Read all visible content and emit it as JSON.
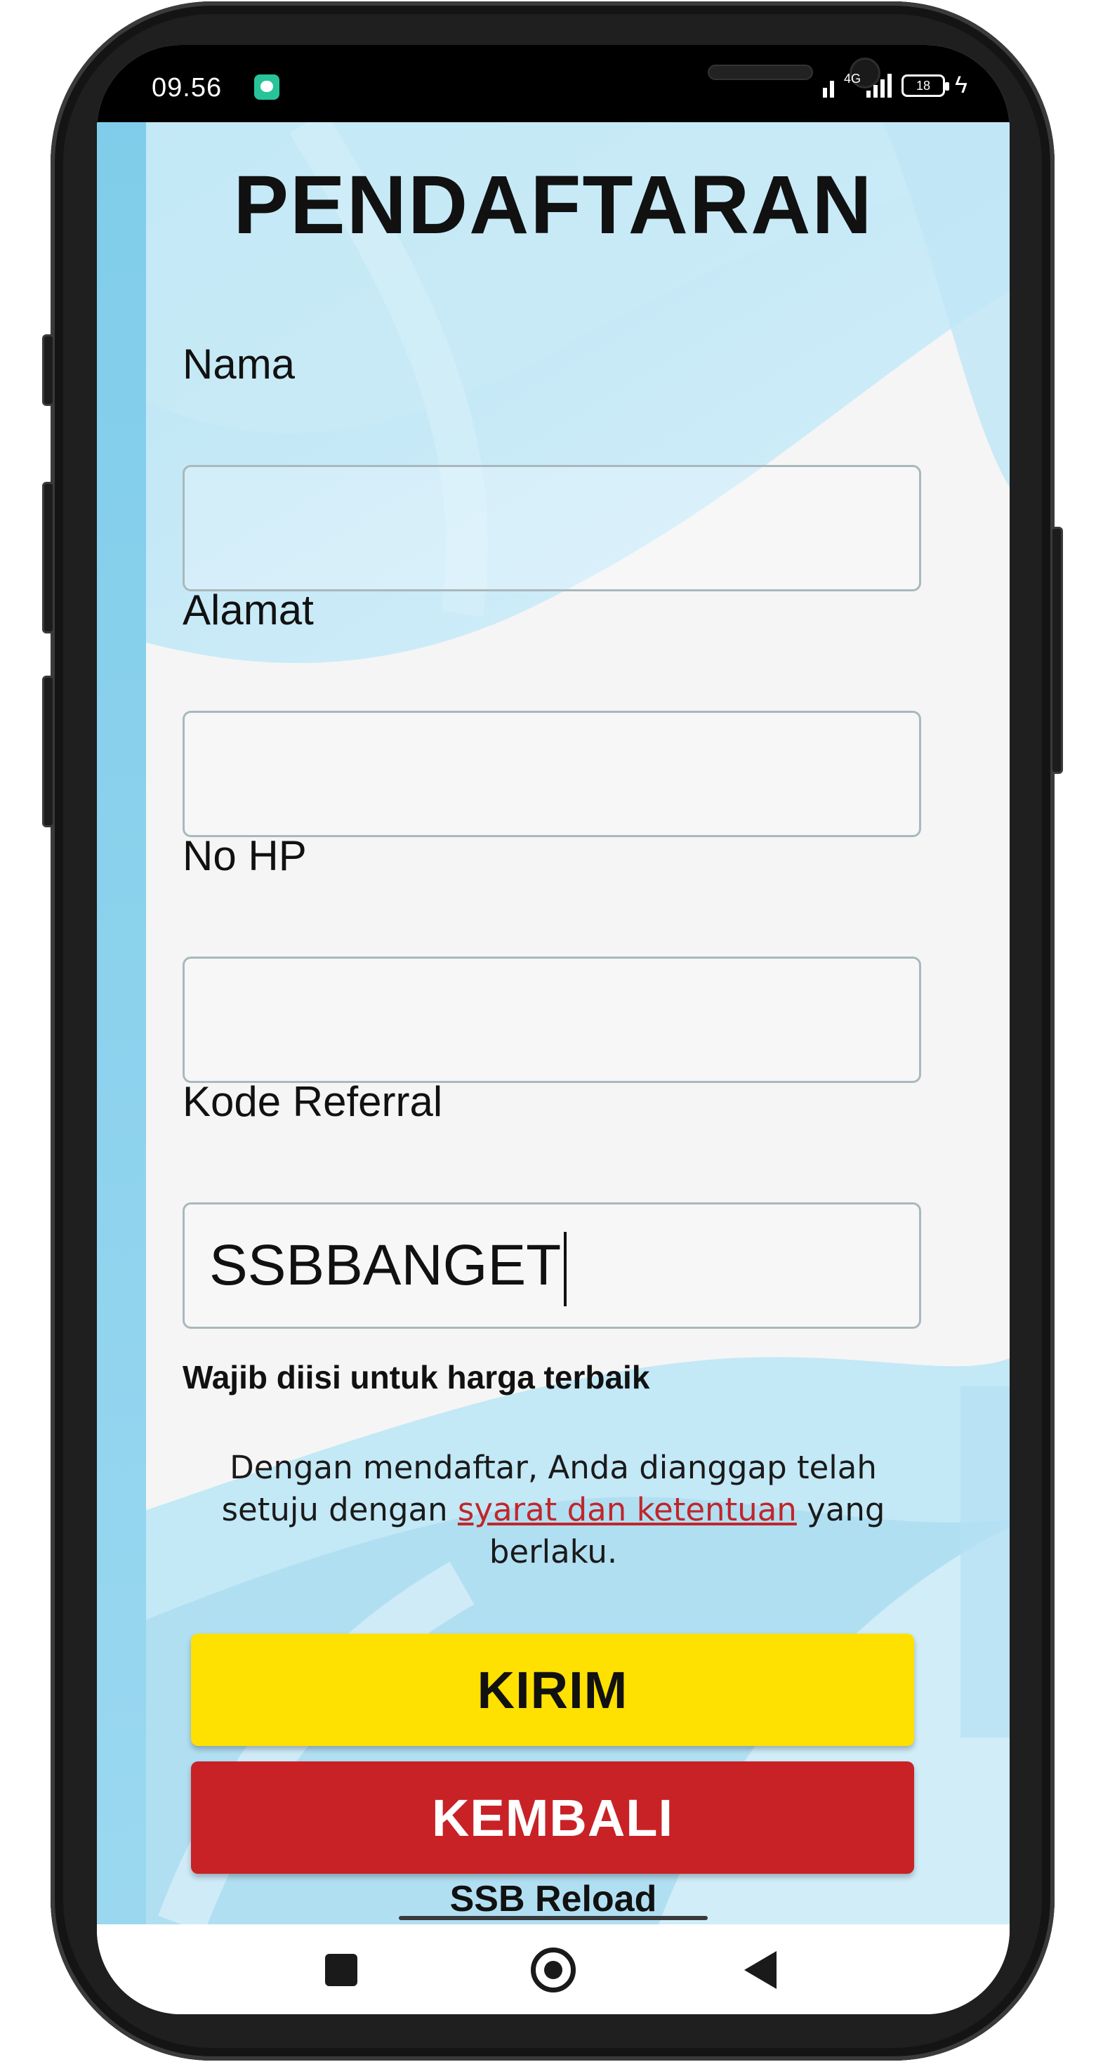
{
  "status_bar": {
    "time": "09.56",
    "network_label": "4G",
    "battery_level": "18"
  },
  "form": {
    "title": "PENDAFTARAN",
    "fields": [
      {
        "label": "Nama",
        "value": ""
      },
      {
        "label": "Alamat",
        "value": ""
      },
      {
        "label": "No HP",
        "value": ""
      },
      {
        "label": "Kode Referral",
        "value": "SSBBANGET"
      }
    ],
    "referral_hint": "Wajib diisi untuk harga terbaik",
    "terms": {
      "before": "Dengan mendaftar, Anda dianggap telah setuju dengan ",
      "link": "syarat dan ketentuan",
      "after": " yang berlaku."
    },
    "submit_label": "KIRIM",
    "back_label": "KEMBALI"
  },
  "footer": {
    "brand": "SSB Reload"
  },
  "colors": {
    "submit_bg": "#fee100",
    "back_bg": "#c82226",
    "link": "#c0262b",
    "background_accent": "#8fd3ee"
  },
  "nav_icons": [
    "recent-apps-icon",
    "home-icon",
    "back-icon"
  ]
}
